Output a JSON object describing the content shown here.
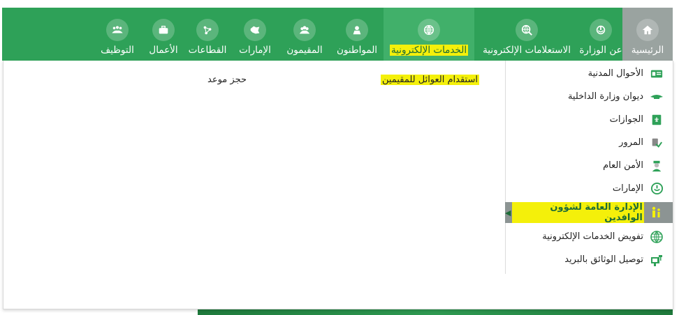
{
  "colors": {
    "nav_green": "#2ea158",
    "nav_active": "#41b06a",
    "home_gray": "#9aa3a0",
    "highlight": "#f4f00a",
    "menu_active_bg": "#8c9493"
  },
  "nav": [
    {
      "label": "الرئيسية",
      "icon": "home-icon"
    },
    {
      "label": "عن الوزارة",
      "icon": "ministry-emblem-icon"
    },
    {
      "label": "الاستعلامات الإلكترونية",
      "icon": "globe-search-icon"
    },
    {
      "label": "الخدمات الإلكترونية",
      "icon": "globe-icon"
    },
    {
      "label": "المواطنون",
      "icon": "citizen-icon"
    },
    {
      "label": "المقيمون",
      "icon": "residents-icon"
    },
    {
      "label": "الإمارات",
      "icon": "regions-icon"
    },
    {
      "label": "القطاعات",
      "icon": "sectors-icon"
    },
    {
      "label": "الأعمال",
      "icon": "briefcase-icon"
    },
    {
      "label": "التوظيف",
      "icon": "employment-icon"
    }
  ],
  "side_menu": [
    {
      "label": "الأحوال المدنية",
      "icon": "id-card-icon"
    },
    {
      "label": "ديوان وزارة الداخلية",
      "icon": "emblem-icon"
    },
    {
      "label": "الجوازات",
      "icon": "passport-icon"
    },
    {
      "label": "المرور",
      "icon": "traffic-icon"
    },
    {
      "label": "الأمن العام",
      "icon": "police-icon"
    },
    {
      "label": "الإمارات",
      "icon": "regions-emblem-icon"
    },
    {
      "label": "الإدارة العامة لشؤون الوافدين",
      "icon": "expatriates-icon"
    },
    {
      "label": "تفويض الخدمات الإلكترونية",
      "icon": "globe-icon"
    },
    {
      "label": "توصيل الوثائق بالبريد",
      "icon": "mailbox-icon"
    }
  ],
  "sub_links": {
    "family_visit": "استقدام العوائل للمقيمين",
    "appointment": "حجز موعد"
  },
  "footer_hint": "—"
}
